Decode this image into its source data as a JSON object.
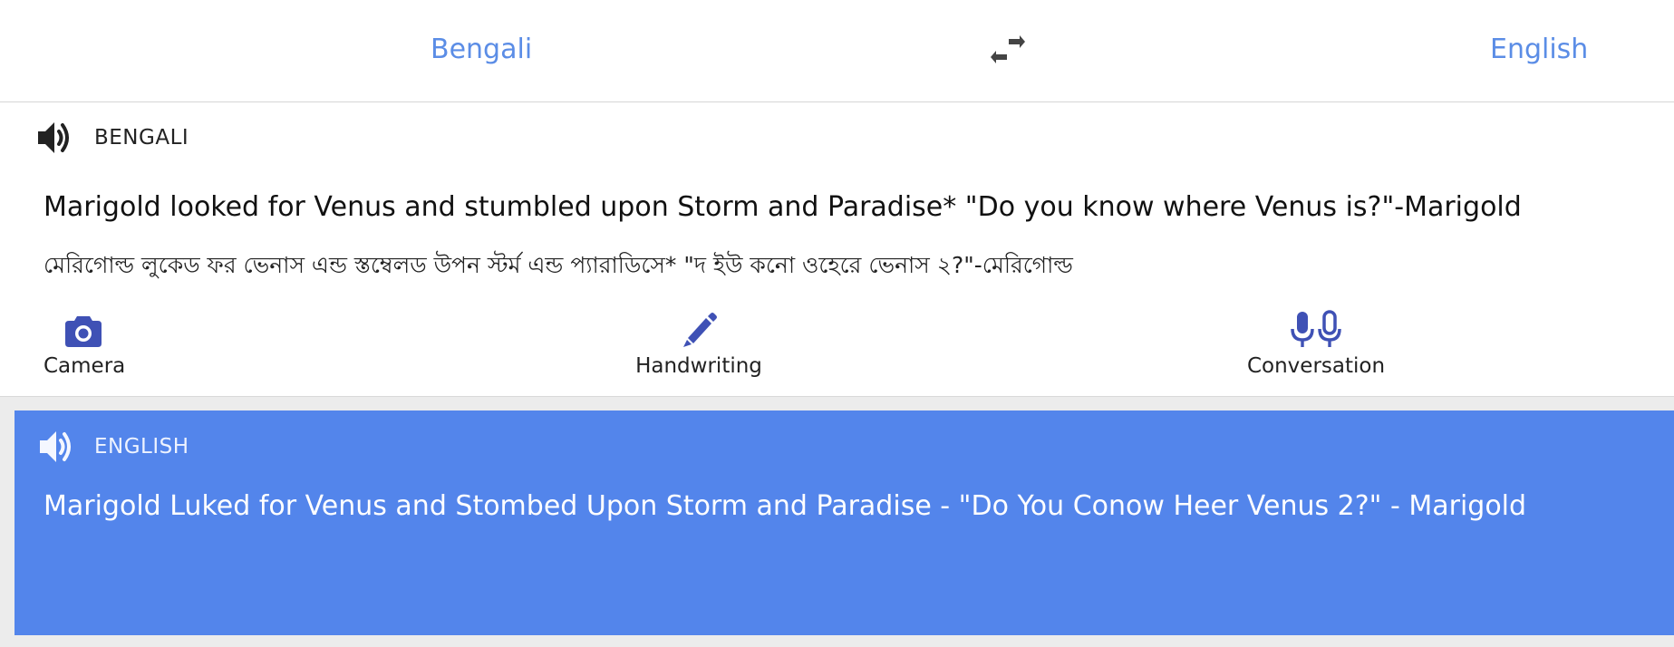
{
  "header": {
    "source_language": "Bengali",
    "target_language": "English",
    "swap_icon": "swap-arrows-icon"
  },
  "source": {
    "language_label": "BENGALI",
    "speaker_icon": "speaker-icon",
    "text": "Marigold looked for Venus and stumbled upon Storm and Paradise* \"Do you know where Venus is?\"-Marigold",
    "transliteration": "মেরিগোল্ড লুকেড ফর ভেনাস এন্ড স্তম্বেলড উপন স্টর্ম এন্ড প্যারাডিসে* \"দ ইউ কনো ওহেরে ভেনাস ২?\"-মেরিগোল্ড"
  },
  "tools": {
    "camera": {
      "label": "Camera",
      "icon": "camera-icon"
    },
    "handwriting": {
      "label": "Handwriting",
      "icon": "pen-icon"
    },
    "conversation": {
      "label": "Conversation",
      "icon": "microphones-icon"
    }
  },
  "result": {
    "language_label": "ENGLISH",
    "speaker_icon": "speaker-icon",
    "text": "Marigold Luked for Venus and Stombed Upon Storm and Paradise - \"Do You Conow Heer Venus 2?\" - Marigold"
  },
  "colors": {
    "accent": "#5b8de6",
    "result_background": "#5385eb",
    "tool_icon": "#3f51b5"
  }
}
